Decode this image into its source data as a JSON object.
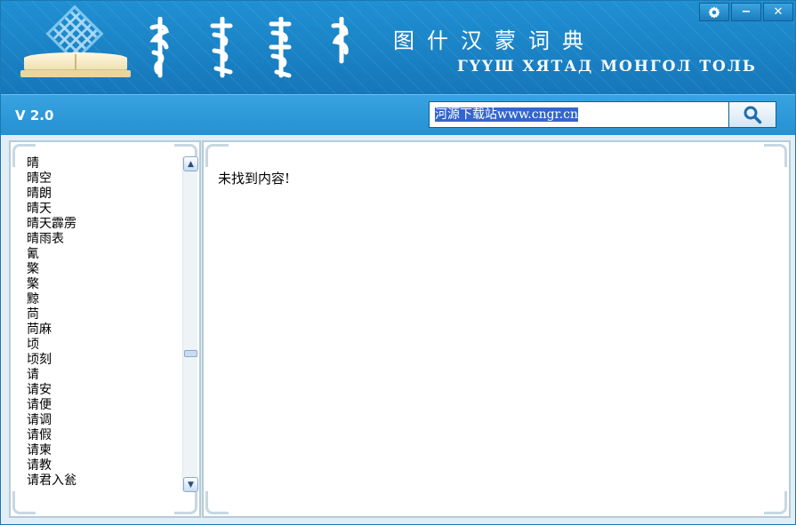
{
  "header": {
    "title_chinese": "图什汉蒙词典",
    "title_mongolian_cyrillic": "ГҮҮШ ХЯТАД МОНГОЛ ТОЛЬ"
  },
  "window_controls": {
    "settings_icon": "gear-icon",
    "minimize_label": "−",
    "close_label": "✕"
  },
  "toolbar": {
    "version": "V 2.0",
    "search_value": "河源下载站www.cngr.cn",
    "search_icon": "search-icon"
  },
  "word_list": {
    "items": [
      "晴",
      "晴空",
      "晴朗",
      "晴天",
      "晴天霹雳",
      "晴雨表",
      "氰",
      "檠",
      "檠",
      "黥",
      "苘",
      "苘麻",
      "顷",
      "顷刻",
      "请",
      "请安",
      "请便",
      "请调",
      "请假",
      "请柬",
      "请教",
      "请君入瓮"
    ]
  },
  "result": {
    "message": "未找到内容!"
  },
  "colors": {
    "header_blue": "#1a82c5",
    "toolbar_blue": "#2590d3",
    "panel_border": "#b4cbda"
  }
}
